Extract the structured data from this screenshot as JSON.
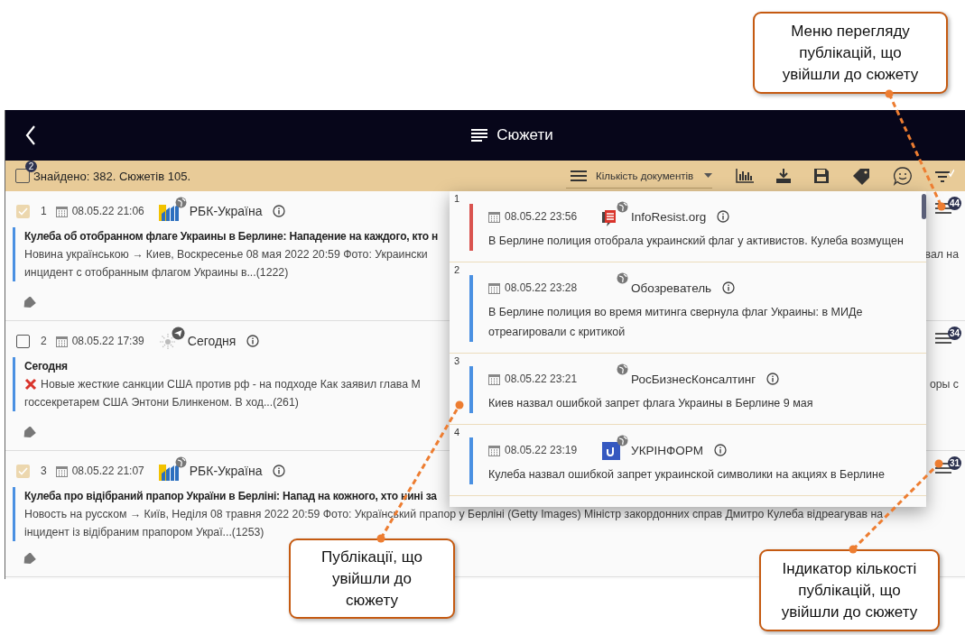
{
  "header": {
    "title": "Сюжети"
  },
  "toolbar": {
    "select_all_checked": false,
    "selected_badge": "2",
    "summary": "Знайдено: 382. Сюжетів 105.",
    "sort_select": {
      "value": "Кількість документів"
    }
  },
  "stories": [
    {
      "checked": true,
      "number": "1",
      "date": "08.05.22 21:06",
      "source": "РБК-Україна",
      "title": "Кулеба об отобранном флаге Украины в Берлине: Нападение на каждого, кто н",
      "lines": [
        {
          "text": "Новина українською → Киев, Воскресенье 08 мая 2022 20:59 Фото: Украински",
          "tail": "вал на"
        },
        {
          "text": "инцидент с отобранным флагом Украины в...(1222)"
        }
      ],
      "count": "44"
    },
    {
      "checked": false,
      "number": "2",
      "date": "08.05.22 17:39",
      "source": "Сегодня",
      "title": "Сегодня",
      "lines": [
        {
          "text": "Новые жесткие санкции США против рф - на подходе Как заявил глава М",
          "tail": "оры с"
        },
        {
          "text": "госсекретарем США Энтони Блинкеном. В ход...(261)"
        }
      ],
      "count": "34"
    },
    {
      "checked": true,
      "number": "3",
      "date": "08.05.22 21:07",
      "source": "РБК-Україна",
      "title": "Кулеба про відібраний прапор України в Берліні: Напад на кожного, хто нині за",
      "lines": [
        {
          "text": "Новость на русском → Київ, Неділя 08 травня 2022 20:59 Фото: Український прапор у Берліні (Getty Images) Міністр закордонних справ Дмитро Кулеба відреагував на"
        },
        {
          "text": "інцидент із відібраним прапором Украї...(1253)"
        }
      ],
      "count": "31"
    }
  ],
  "popup": {
    "items": [
      {
        "number": "1",
        "color": "#d9534f",
        "date": "08.05.22 23:56",
        "source": "InfoResist.org",
        "title": "В Берлине полиция отобрала украинский флаг у активистов. Кулеба возмущен"
      },
      {
        "number": "2",
        "color": "#4a90e2",
        "date": "08.05.22 23:28",
        "source": "Обозреватель",
        "title": "В Берлине полиция во время митинга свернула флаг Украины: в МИДе отреагировали с критикой"
      },
      {
        "number": "3",
        "color": "#4a90e2",
        "date": "08.05.22 23:21",
        "source": "РосБизнесКонсалтинг",
        "title": "Киев назвал ошибкой запрет флага Украины в Берлине 9 мая"
      },
      {
        "number": "4",
        "color": "#4a90e2",
        "date": "08.05.22 23:19",
        "source": "УКРІНФОРМ",
        "title": "Кулеба назвал ошибкой запрет украинской символики на акциях в Берлине"
      }
    ]
  },
  "callouts": [
    {
      "text": "Меню перегляду публікацій, що увійшли до сюжету"
    },
    {
      "text": "Публікації, що увійшли до сюжету"
    },
    {
      "text": "Індикатор кількості публікацій, що увійшли до сюжету"
    }
  ]
}
